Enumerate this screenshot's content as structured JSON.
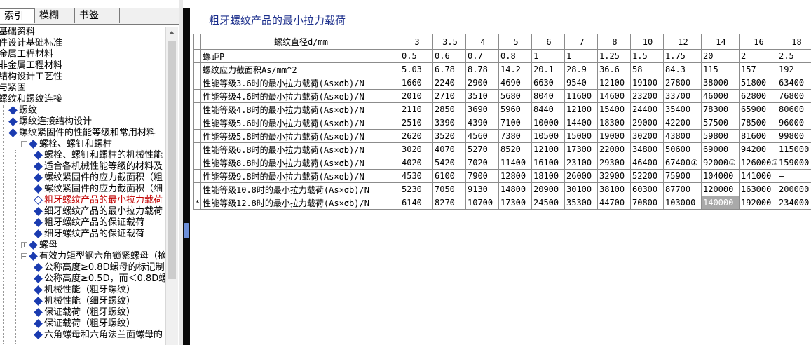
{
  "tabs": [
    "索引",
    "模糊",
    "书签"
  ],
  "tree": [
    {
      "text": "基础资料",
      "level": 0,
      "icon": "none"
    },
    {
      "text": "件设计基础标准",
      "level": 0,
      "icon": "none"
    },
    {
      "text": "金属工程材料",
      "level": 0,
      "icon": "none"
    },
    {
      "text": "非金属工程材料",
      "level": 0,
      "icon": "none"
    },
    {
      "text": "结构设计工艺性",
      "level": 0,
      "icon": "none"
    },
    {
      "text": "与紧固",
      "level": 0,
      "icon": "none"
    },
    {
      "text": "螺纹和螺纹连接",
      "level": 0,
      "icon": "none"
    },
    {
      "text": "螺纹",
      "level": 1,
      "icon": "book-icon"
    },
    {
      "text": "螺纹连接结构设计",
      "level": 1,
      "icon": "book-icon"
    },
    {
      "text": "螺纹紧固件的性能等级和常用材料",
      "level": 1,
      "icon": "book-icon"
    },
    {
      "text": "螺栓、螺钉和螺柱",
      "level": 2,
      "icon": "book-icon"
    },
    {
      "text": "螺栓、螺钉和螺柱的机械性能",
      "level": 3,
      "icon": "page-icon"
    },
    {
      "text": "适合各机械性能等级的材料及",
      "level": 3,
      "icon": "page-icon"
    },
    {
      "text": "螺纹紧固件的应力截面积（粗",
      "level": 3,
      "icon": "page-icon"
    },
    {
      "text": "螺纹紧固件的应力截面积（细",
      "level": 3,
      "icon": "page-icon"
    },
    {
      "text": "粗牙螺纹产品的最小拉力载荷",
      "level": 3,
      "icon": "page-open-icon",
      "selected": true
    },
    {
      "text": "细牙螺纹产品的最小拉力载荷",
      "level": 3,
      "icon": "page-icon"
    },
    {
      "text": "粗牙螺纹产品的保证载荷",
      "level": 3,
      "icon": "page-icon"
    },
    {
      "text": "细牙螺纹产品的保证载荷",
      "level": 3,
      "icon": "page-icon"
    },
    {
      "text": "螺母",
      "level": 2,
      "icon": "book-icon"
    },
    {
      "text": "有效力矩型钢六角锁紧螺母（摘自",
      "level": 2,
      "icon": "book-icon"
    },
    {
      "text": "公称高度≥0.8D螺母的标记制",
      "level": 3,
      "icon": "page-icon"
    },
    {
      "text": "公称高度≥0.5D，而＜0.8D螺",
      "level": 3,
      "icon": "page-icon"
    },
    {
      "text": "机械性能（粗牙螺纹）",
      "level": 3,
      "icon": "page-icon"
    },
    {
      "text": "机械性能（细牙螺纹）",
      "level": 3,
      "icon": "page-icon"
    },
    {
      "text": "保证载荷（粗牙螺纹）",
      "level": 3,
      "icon": "page-icon"
    },
    {
      "text": "保证载荷（粗牙螺纹）",
      "level": 3,
      "icon": "page-icon"
    },
    {
      "text": "六角螺母和六角法兰面螺母的",
      "level": 3,
      "icon": "page-icon"
    }
  ],
  "page_title": "粗牙螺纹产品的最小拉力载荷",
  "table": {
    "header_first": "螺纹直径d/mm",
    "header_cols": [
      "3",
      "3.5",
      "4",
      "5",
      "6",
      "7",
      "8",
      "10",
      "12",
      "14",
      "16",
      "18"
    ],
    "rows": [
      {
        "marker": "",
        "label": "螺距P",
        "values": [
          "0.5",
          "0.6",
          "0.7",
          "0.8",
          "1",
          "1",
          "1.25",
          "1.5",
          "1.75",
          "20",
          "2",
          "2.5"
        ]
      },
      {
        "marker": "",
        "label": "螺纹应力截面积As/mm^2",
        "values": [
          "5.03",
          "6.78",
          "8.78",
          "14.2",
          "20.1",
          "28.9",
          "36.6",
          "58",
          "84.3",
          "115",
          "157",
          "192"
        ]
      },
      {
        "marker": "",
        "label": "性能等级3.6时的最小拉力载荷(As×σb)/N",
        "values": [
          "1660",
          "2240",
          "2900",
          "4690",
          "6630",
          "9540",
          "12100",
          "19100",
          "27800",
          "38000",
          "51800",
          "63400"
        ]
      },
      {
        "marker": "",
        "label": "性能等级4.6时的最小拉力载荷(As×σb)/N",
        "values": [
          "2010",
          "2710",
          "3510",
          "5680",
          "8040",
          "11600",
          "14600",
          "23200",
          "33700",
          "46000",
          "62800",
          "76800"
        ]
      },
      {
        "marker": "",
        "label": "性能等级4.8时的最小拉力载荷(As×σb)/N",
        "values": [
          "2110",
          "2850",
          "3690",
          "5960",
          "8440",
          "12100",
          "15400",
          "24400",
          "35400",
          "78300",
          "65900",
          "80600"
        ]
      },
      {
        "marker": "",
        "label": "性能等级5.6时的最小拉力载荷(As×σb)/N",
        "values": [
          "2510",
          "3390",
          "4390",
          "7100",
          "10000",
          "14400",
          "18300",
          "29000",
          "42200",
          "57500",
          "78500",
          "96000"
        ]
      },
      {
        "marker": "",
        "label": "性能等级5.8时的最小拉力载荷(As×σb)/N",
        "values": [
          "2620",
          "3520",
          "4560",
          "7380",
          "10500",
          "15000",
          "19000",
          "30200",
          "43800",
          "59800",
          "81600",
          "99800"
        ]
      },
      {
        "marker": "",
        "label": "性能等级6.8时的最小拉力载荷(As×σb)/N",
        "values": [
          "3020",
          "4070",
          "5270",
          "8520",
          "12100",
          "17300",
          "22000",
          "34800",
          "50600",
          "69000",
          "94200",
          "115000"
        ]
      },
      {
        "marker": "",
        "label": "性能等级8.8时的最小拉力载荷(As×σb)/N",
        "values": [
          "4020",
          "5420",
          "7020",
          "11400",
          "16100",
          "23100",
          "29300",
          "46400",
          "67400①",
          "92000①",
          "126000①",
          "159000"
        ]
      },
      {
        "marker": "",
        "label": "性能等级9.8时的最小拉力载荷(As×σb)/N",
        "values": [
          "4530",
          "6100",
          "7900",
          "12800",
          "18100",
          "26000",
          "32900",
          "52200",
          "75900",
          "104000",
          "141000",
          "—"
        ]
      },
      {
        "marker": "",
        "label": "性能等级10.8时的最小拉力载荷(As×σb)/N",
        "values": [
          "5230",
          "7050",
          "9130",
          "14800",
          "20900",
          "30100",
          "38100",
          "60300",
          "87700",
          "120000",
          "163000",
          "200000"
        ]
      },
      {
        "marker": "*",
        "label": "性能等级12.8时的最小拉力载荷(As×σb)/N",
        "values": [
          "6140",
          "8270",
          "10700",
          "17300",
          "24500",
          "35300",
          "44700",
          "70800",
          "103000",
          "140000",
          "192000",
          "234000"
        ],
        "highlight_col": 9
      }
    ]
  },
  "colors": {
    "title": "#1c2f8c",
    "selected_tree_item": "#c00000",
    "tree_icon": "#1a3bb0",
    "highlight_cell": "#a9a9a9"
  }
}
